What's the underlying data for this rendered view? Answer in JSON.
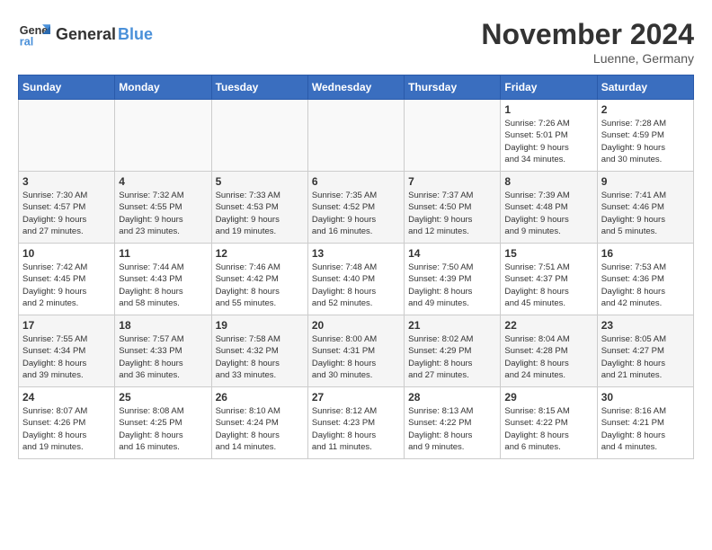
{
  "logo": {
    "line1": "General",
    "line2": "Blue"
  },
  "title": "November 2024",
  "location": "Luenne, Germany",
  "days_of_week": [
    "Sunday",
    "Monday",
    "Tuesday",
    "Wednesday",
    "Thursday",
    "Friday",
    "Saturday"
  ],
  "weeks": [
    [
      {
        "day": "",
        "info": ""
      },
      {
        "day": "",
        "info": ""
      },
      {
        "day": "",
        "info": ""
      },
      {
        "day": "",
        "info": ""
      },
      {
        "day": "",
        "info": ""
      },
      {
        "day": "1",
        "info": "Sunrise: 7:26 AM\nSunset: 5:01 PM\nDaylight: 9 hours\nand 34 minutes."
      },
      {
        "day": "2",
        "info": "Sunrise: 7:28 AM\nSunset: 4:59 PM\nDaylight: 9 hours\nand 30 minutes."
      }
    ],
    [
      {
        "day": "3",
        "info": "Sunrise: 7:30 AM\nSunset: 4:57 PM\nDaylight: 9 hours\nand 27 minutes."
      },
      {
        "day": "4",
        "info": "Sunrise: 7:32 AM\nSunset: 4:55 PM\nDaylight: 9 hours\nand 23 minutes."
      },
      {
        "day": "5",
        "info": "Sunrise: 7:33 AM\nSunset: 4:53 PM\nDaylight: 9 hours\nand 19 minutes."
      },
      {
        "day": "6",
        "info": "Sunrise: 7:35 AM\nSunset: 4:52 PM\nDaylight: 9 hours\nand 16 minutes."
      },
      {
        "day": "7",
        "info": "Sunrise: 7:37 AM\nSunset: 4:50 PM\nDaylight: 9 hours\nand 12 minutes."
      },
      {
        "day": "8",
        "info": "Sunrise: 7:39 AM\nSunset: 4:48 PM\nDaylight: 9 hours\nand 9 minutes."
      },
      {
        "day": "9",
        "info": "Sunrise: 7:41 AM\nSunset: 4:46 PM\nDaylight: 9 hours\nand 5 minutes."
      }
    ],
    [
      {
        "day": "10",
        "info": "Sunrise: 7:42 AM\nSunset: 4:45 PM\nDaylight: 9 hours\nand 2 minutes."
      },
      {
        "day": "11",
        "info": "Sunrise: 7:44 AM\nSunset: 4:43 PM\nDaylight: 8 hours\nand 58 minutes."
      },
      {
        "day": "12",
        "info": "Sunrise: 7:46 AM\nSunset: 4:42 PM\nDaylight: 8 hours\nand 55 minutes."
      },
      {
        "day": "13",
        "info": "Sunrise: 7:48 AM\nSunset: 4:40 PM\nDaylight: 8 hours\nand 52 minutes."
      },
      {
        "day": "14",
        "info": "Sunrise: 7:50 AM\nSunset: 4:39 PM\nDaylight: 8 hours\nand 49 minutes."
      },
      {
        "day": "15",
        "info": "Sunrise: 7:51 AM\nSunset: 4:37 PM\nDaylight: 8 hours\nand 45 minutes."
      },
      {
        "day": "16",
        "info": "Sunrise: 7:53 AM\nSunset: 4:36 PM\nDaylight: 8 hours\nand 42 minutes."
      }
    ],
    [
      {
        "day": "17",
        "info": "Sunrise: 7:55 AM\nSunset: 4:34 PM\nDaylight: 8 hours\nand 39 minutes."
      },
      {
        "day": "18",
        "info": "Sunrise: 7:57 AM\nSunset: 4:33 PM\nDaylight: 8 hours\nand 36 minutes."
      },
      {
        "day": "19",
        "info": "Sunrise: 7:58 AM\nSunset: 4:32 PM\nDaylight: 8 hours\nand 33 minutes."
      },
      {
        "day": "20",
        "info": "Sunrise: 8:00 AM\nSunset: 4:31 PM\nDaylight: 8 hours\nand 30 minutes."
      },
      {
        "day": "21",
        "info": "Sunrise: 8:02 AM\nSunset: 4:29 PM\nDaylight: 8 hours\nand 27 minutes."
      },
      {
        "day": "22",
        "info": "Sunrise: 8:04 AM\nSunset: 4:28 PM\nDaylight: 8 hours\nand 24 minutes."
      },
      {
        "day": "23",
        "info": "Sunrise: 8:05 AM\nSunset: 4:27 PM\nDaylight: 8 hours\nand 21 minutes."
      }
    ],
    [
      {
        "day": "24",
        "info": "Sunrise: 8:07 AM\nSunset: 4:26 PM\nDaylight: 8 hours\nand 19 minutes."
      },
      {
        "day": "25",
        "info": "Sunrise: 8:08 AM\nSunset: 4:25 PM\nDaylight: 8 hours\nand 16 minutes."
      },
      {
        "day": "26",
        "info": "Sunrise: 8:10 AM\nSunset: 4:24 PM\nDaylight: 8 hours\nand 14 minutes."
      },
      {
        "day": "27",
        "info": "Sunrise: 8:12 AM\nSunset: 4:23 PM\nDaylight: 8 hours\nand 11 minutes."
      },
      {
        "day": "28",
        "info": "Sunrise: 8:13 AM\nSunset: 4:22 PM\nDaylight: 8 hours\nand 9 minutes."
      },
      {
        "day": "29",
        "info": "Sunrise: 8:15 AM\nSunset: 4:22 PM\nDaylight: 8 hours\nand 6 minutes."
      },
      {
        "day": "30",
        "info": "Sunrise: 8:16 AM\nSunset: 4:21 PM\nDaylight: 8 hours\nand 4 minutes."
      }
    ]
  ]
}
